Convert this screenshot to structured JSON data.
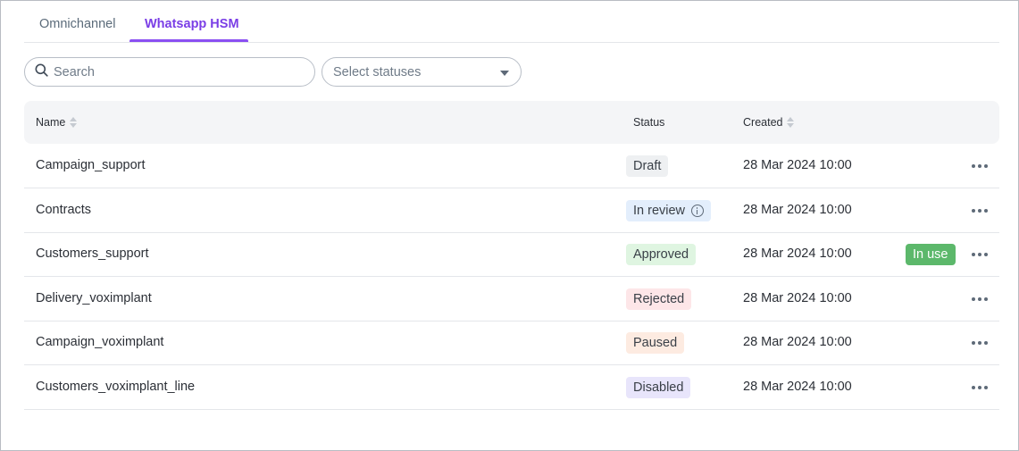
{
  "tabs": [
    {
      "label": "Omnichannel",
      "active": false
    },
    {
      "label": "Whatsapp HSM",
      "active": true
    }
  ],
  "filters": {
    "search_placeholder": "Search",
    "status_placeholder": "Select statuses"
  },
  "table": {
    "columns": {
      "name": "Name",
      "status": "Status",
      "created": "Created"
    },
    "rows": [
      {
        "name": "Campaign_support",
        "status": "Draft",
        "created": "28 Mar 2024 10:00",
        "in_use": "",
        "status_bg": "#eef0f2",
        "status_fg": "#3a4048"
      },
      {
        "name": "Contracts",
        "status": "In review",
        "created": "28 Mar 2024 10:00",
        "in_use": "",
        "status_bg": "#e3eefc",
        "status_fg": "#3a4048"
      },
      {
        "name": "Customers_support",
        "status": "Approved",
        "created": "28 Mar 2024 10:00",
        "in_use": "In use",
        "status_bg": "#dff5e1",
        "status_fg": "#3a4048"
      },
      {
        "name": "Delivery_voximplant",
        "status": "Rejected",
        "created": "28 Mar 2024 10:00",
        "in_use": "",
        "status_bg": "#fde6e8",
        "status_fg": "#3a4048"
      },
      {
        "name": "Campaign_voximplant",
        "status": "Paused",
        "created": "28 Mar 2024 10:00",
        "in_use": "",
        "status_bg": "#fdebe1",
        "status_fg": "#3a4048"
      },
      {
        "name": "Customers_voximplant_line",
        "status": "Disabled",
        "created": "28 Mar 2024 10:00",
        "in_use": "",
        "status_bg": "#e8e5fb",
        "status_fg": "#3a4048"
      }
    ]
  },
  "colors": {
    "accent": "#8a4ff2",
    "in_use_bg": "#5cb86b"
  }
}
